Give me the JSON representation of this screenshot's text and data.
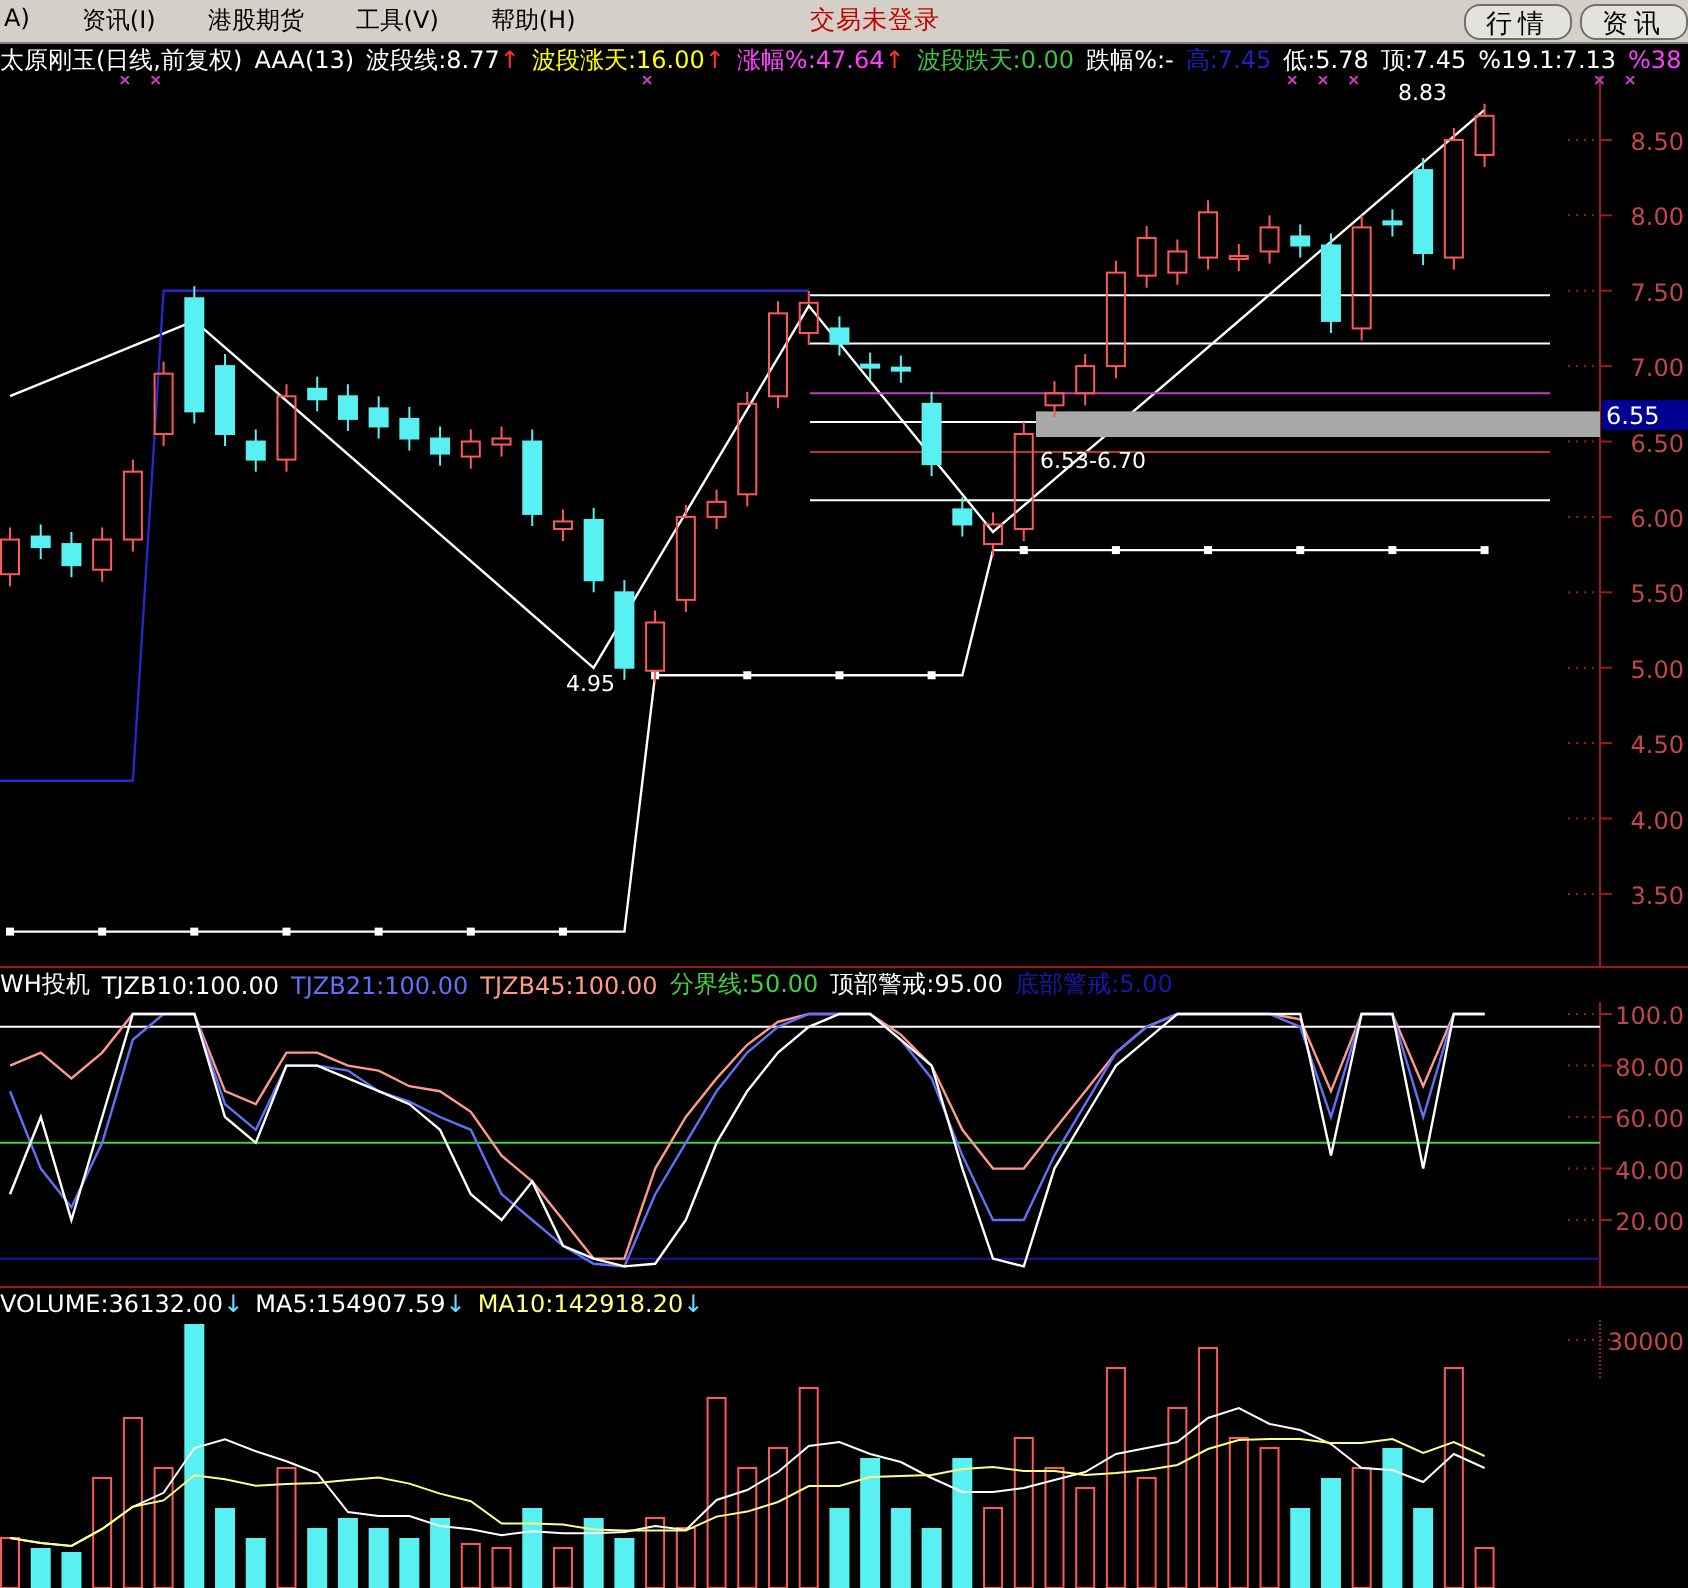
{
  "menu_bar": {
    "items": [
      {
        "label": "A)"
      },
      {
        "label": "资讯(I)"
      },
      {
        "label": "港股期货"
      },
      {
        "label": "工具(V)"
      },
      {
        "label": "帮助(H)"
      }
    ],
    "status": "交易未登录",
    "buttons": [
      {
        "label": "行情"
      },
      {
        "label": "资讯"
      }
    ]
  },
  "price_panel": {
    "legend": [
      {
        "text": "太原刚玉(日线,前复权)",
        "color": "#ffffff"
      },
      {
        "text": "AAA(13)",
        "color": "#ffffff"
      },
      {
        "text": "波段线:8.77",
        "color": "#ffffff",
        "arrow": "↑"
      },
      {
        "text": "波段涨天:16.00",
        "color": "#ffff00",
        "arrow": "↑"
      },
      {
        "text": "涨幅%:47.64",
        "color": "#ff40ff",
        "arrow": "↑"
      },
      {
        "text": "波段跌天:0.00",
        "color": "#40c040"
      },
      {
        "text": "跌幅%:-",
        "color": "#ffffff"
      },
      {
        "text": "高:7.45",
        "color": "#2020c0"
      },
      {
        "text": "低:5.78",
        "color": "#ffffff"
      },
      {
        "text": "顶:7.45",
        "color": "#ffffff"
      },
      {
        "text": "%19.1:7.13",
        "color": "#ffffff"
      },
      {
        "text": "%38",
        "color": "#ff40ff"
      }
    ],
    "cursor_price": "6.55",
    "chart_data": {
      "type": "candlestick",
      "ylim": [
        3.022,
        8.924
      ],
      "ohlc": [
        [
          5.62,
          5.93,
          5.54,
          5.85
        ],
        [
          5.87,
          5.95,
          5.72,
          5.8
        ],
        [
          5.82,
          5.9,
          5.6,
          5.68
        ],
        [
          5.65,
          5.93,
          5.57,
          5.85
        ],
        [
          5.85,
          6.38,
          5.77,
          6.3
        ],
        [
          6.55,
          7.03,
          6.47,
          6.95
        ],
        [
          7.45,
          7.53,
          6.62,
          6.7
        ],
        [
          7.0,
          7.08,
          6.47,
          6.55
        ],
        [
          6.5,
          6.58,
          6.3,
          6.38
        ],
        [
          6.38,
          6.88,
          6.3,
          6.8
        ],
        [
          6.85,
          6.93,
          6.7,
          6.78
        ],
        [
          6.8,
          6.88,
          6.57,
          6.65
        ],
        [
          6.72,
          6.8,
          6.52,
          6.6
        ],
        [
          6.65,
          6.73,
          6.44,
          6.52
        ],
        [
          6.52,
          6.6,
          6.34,
          6.42
        ],
        [
          6.4,
          6.58,
          6.32,
          6.5
        ],
        [
          6.48,
          6.6,
          6.4,
          6.52
        ],
        [
          6.5,
          6.58,
          5.94,
          6.02
        ],
        [
          5.92,
          6.05,
          5.84,
          5.97
        ],
        [
          5.98,
          6.06,
          5.5,
          5.58
        ],
        [
          5.5,
          5.58,
          4.92,
          5.0
        ],
        [
          4.98,
          5.38,
          4.9,
          5.3
        ],
        [
          5.45,
          6.08,
          5.37,
          6.0
        ],
        [
          6.0,
          6.18,
          5.92,
          6.1
        ],
        [
          6.15,
          6.83,
          6.07,
          6.75
        ],
        [
          6.8,
          7.43,
          6.72,
          7.35
        ],
        [
          7.22,
          7.5,
          7.14,
          7.42
        ],
        [
          7.25,
          7.33,
          7.07,
          7.15
        ],
        [
          7.01,
          7.09,
          6.91,
          6.99
        ],
        [
          6.99,
          7.07,
          6.89,
          6.97
        ],
        [
          6.75,
          6.83,
          6.27,
          6.35
        ],
        [
          6.05,
          6.13,
          5.87,
          5.95
        ],
        [
          5.82,
          6.03,
          5.74,
          5.95
        ],
        [
          5.92,
          6.63,
          5.84,
          6.55
        ],
        [
          6.74,
          6.9,
          6.66,
          6.82
        ],
        [
          6.82,
          7.08,
          6.74,
          7.0
        ],
        [
          7.0,
          7.7,
          6.92,
          7.62
        ],
        [
          7.6,
          7.93,
          7.52,
          7.85
        ],
        [
          7.62,
          7.84,
          7.54,
          7.76
        ],
        [
          7.72,
          8.1,
          7.64,
          8.02
        ],
        [
          7.71,
          7.81,
          7.63,
          7.73
        ],
        [
          7.76,
          8.0,
          7.68,
          7.92
        ],
        [
          7.86,
          7.94,
          7.72,
          7.8
        ],
        [
          7.8,
          7.88,
          7.22,
          7.3
        ],
        [
          7.25,
          8.0,
          7.17,
          7.92
        ],
        [
          7.96,
          8.04,
          7.86,
          7.94
        ],
        [
          8.3,
          8.38,
          7.67,
          7.75
        ],
        [
          7.72,
          8.58,
          7.64,
          8.5
        ],
        [
          8.4,
          8.74,
          8.32,
          8.66
        ]
      ],
      "yticks": [
        {
          "value": 3.5,
          "label": "3.50"
        },
        {
          "value": 4,
          "label": "4.00"
        },
        {
          "value": 4.5,
          "label": "4.50"
        },
        {
          "value": 5,
          "label": "5.00"
        },
        {
          "value": 5.5,
          "label": "5.50"
        },
        {
          "value": 6,
          "label": "6.00"
        },
        {
          "value": 6.5,
          "label": "6.50"
        },
        {
          "value": 7,
          "label": "7.00"
        },
        {
          "value": 7.5,
          "label": "7.50"
        },
        {
          "value": 8,
          "label": "8.00"
        },
        {
          "value": 8.5,
          "label": "8.50"
        }
      ],
      "ref_lines": [
        {
          "axis": "y",
          "value": 7.47,
          "color": "#ffffff"
        },
        {
          "axis": "y",
          "value": 7.15,
          "color": "#ffffff"
        },
        {
          "axis": "y",
          "value": 6.82,
          "color": "#c040c0"
        },
        {
          "axis": "y",
          "value": 6.63,
          "color": "#ffffff"
        },
        {
          "axis": "y",
          "value": 6.43,
          "color": "#c03030"
        },
        {
          "axis": "y",
          "value": 6.11,
          "color": "#ffffff"
        }
      ],
      "bands": [
        {
          "axis": "y",
          "from": 6.53,
          "to": 6.7,
          "color": "#a8a8a8"
        }
      ],
      "annotations": [
        "4.95",
        "6.53-6.70",
        "8.83"
      ]
    }
  },
  "indicator_panel": {
    "title": "WH投机",
    "chart_data": {
      "type": "line",
      "ylim": [
        -5.63,
        104.66
      ],
      "yticks": [
        {
          "value": 20,
          "label": "20.00"
        },
        {
          "value": 40,
          "label": "40.00"
        },
        {
          "value": 60,
          "label": "60.00"
        },
        {
          "value": 80,
          "label": "80.00"
        },
        {
          "value": 100,
          "label": "100.0"
        }
      ],
      "series": [
        {
          "name": "TJZB10:100.00",
          "color": "#ffffff",
          "values": [
            30,
            60,
            20,
            60,
            100,
            100,
            100,
            60,
            50,
            80,
            80,
            75,
            70,
            65,
            55,
            30,
            20,
            35,
            10,
            5,
            2,
            3,
            20,
            50,
            70,
            85,
            95,
            100,
            100,
            90,
            80,
            40,
            5,
            2,
            40,
            60,
            80,
            90,
            100,
            100,
            100,
            100,
            100,
            45,
            100,
            100,
            40,
            100,
            100
          ]
        },
        {
          "name": "TJZB21:100.00",
          "color": "#6070f8",
          "values": [
            70,
            40,
            25,
            50,
            90,
            100,
            100,
            65,
            55,
            80,
            80,
            78,
            70,
            66,
            60,
            55,
            30,
            20,
            10,
            3,
            2,
            30,
            50,
            70,
            85,
            95,
            100,
            100,
            100,
            90,
            75,
            45,
            20,
            20,
            45,
            65,
            85,
            95,
            100,
            100,
            100,
            100,
            95,
            60,
            100,
            100,
            60,
            100,
            100
          ]
        },
        {
          "name": "TJZB45:100.00",
          "color": "#ff9a8a",
          "values": [
            80,
            85,
            75,
            85,
            100,
            100,
            100,
            70,
            65,
            85,
            85,
            80,
            78,
            72,
            70,
            62,
            45,
            35,
            20,
            5,
            5,
            40,
            60,
            75,
            88,
            97,
            100,
            100,
            100,
            92,
            80,
            55,
            40,
            40,
            55,
            70,
            85,
            95,
            100,
            100,
            100,
            100,
            98,
            70,
            100,
            100,
            72,
            100,
            100
          ]
        }
      ],
      "ref_lines": [
        {
          "axis": "y",
          "value": 50,
          "label": "分界线:50.00",
          "color": "#40d040"
        },
        {
          "axis": "y",
          "value": 95,
          "label": "顶部警戒:95.00",
          "color": "#ffffff"
        },
        {
          "axis": "y",
          "value": 5,
          "label": "底部警戒:5.00",
          "color": "#1818b0"
        }
      ]
    }
  },
  "volume_panel": {
    "legend": [
      {
        "text": "VOLUME:36132.00",
        "color": "#ffffff",
        "arrow": "↓"
      },
      {
        "text": "MA5:154907.59",
        "color": "#ffffff",
        "arrow": "↓"
      },
      {
        "text": "MA10:142918.20",
        "color": "#ffff80",
        "arrow": "↓"
      }
    ],
    "tick": "30000"
  }
}
